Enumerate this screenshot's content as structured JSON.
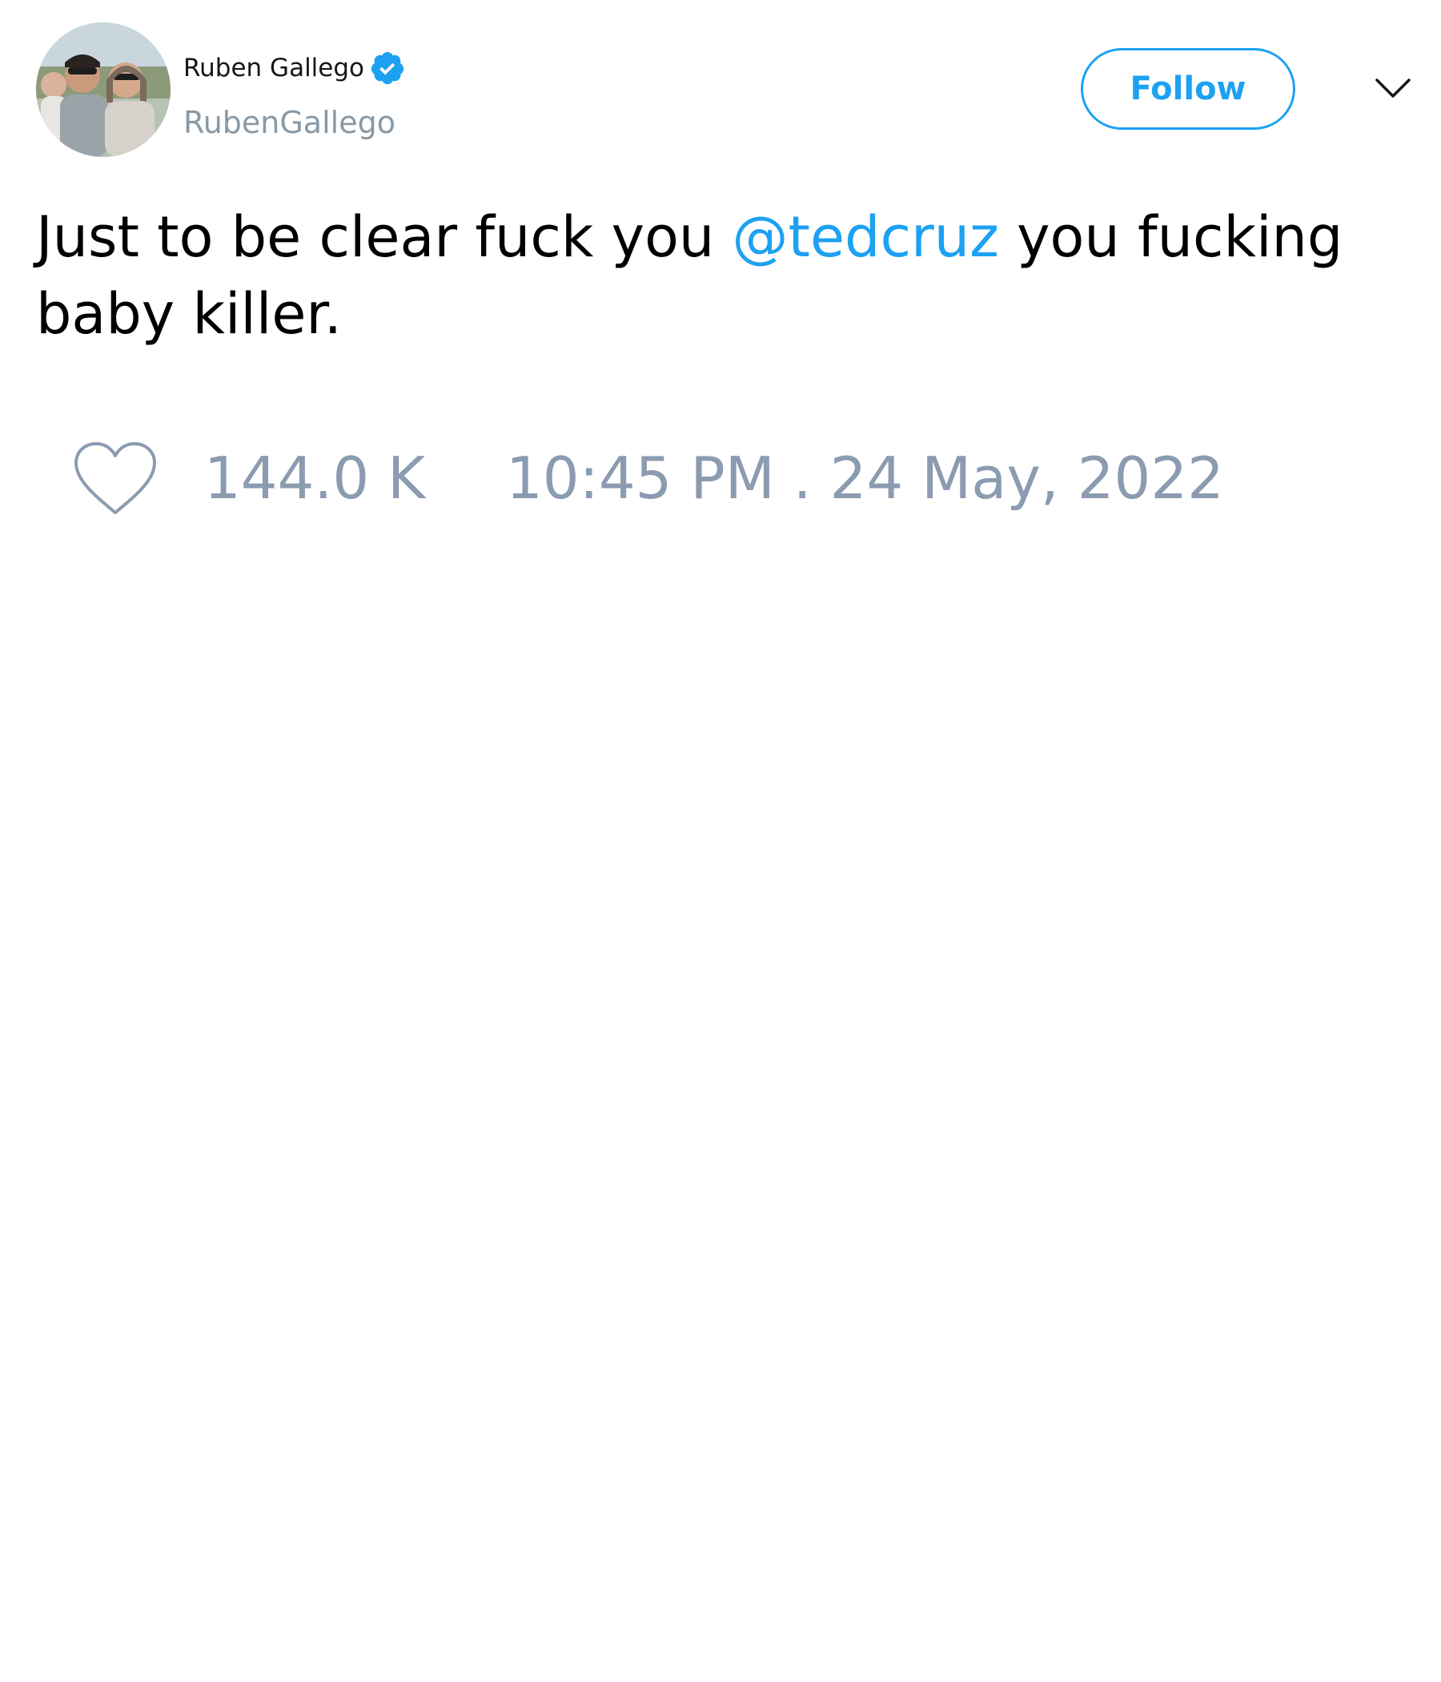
{
  "author": {
    "display_name": "Ruben Gallego",
    "handle": "RubenGallego",
    "verified": true,
    "avatar_icon": "profile-photo"
  },
  "actions": {
    "follow_label": "Follow",
    "menu_icon": "chevron-down-icon"
  },
  "tweet": {
    "text_before": "Just to be clear fuck you ",
    "mention": "@tedcruz",
    "text_after": " you fucking baby killer."
  },
  "footer": {
    "like_icon": "heart-icon",
    "likes": "144.0 K",
    "timestamp": "10:45 PM . 24 May, 2022"
  },
  "colors": {
    "accent": "#1da1f2",
    "muted": "#8b9bb0",
    "text": "#000000"
  }
}
